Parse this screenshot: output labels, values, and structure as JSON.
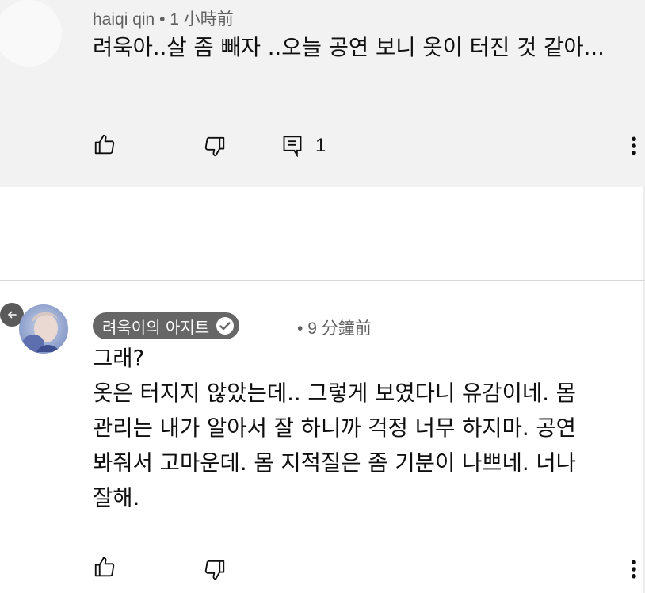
{
  "comments": [
    {
      "author": "haiqi qin",
      "separator": "•",
      "time": "1 小時前",
      "text": "려욱아..살 좀 빼자 ..오늘 공연 보니 옷이 터진 것 같아...",
      "reply_count": "1",
      "icons": [
        "like-icon",
        "dislike-icon",
        "reply-icon",
        "more-vert-icon"
      ]
    },
    {
      "author": "려욱이의 아지트",
      "author_verified": true,
      "separator": "•",
      "time": "9 分鐘前",
      "lines": [
        "그래?",
        "옷은 터지지 않았는데.. 그렇게 보였다니 유감이네. 몸",
        "관리는 내가 알아서 잘 하니까 걱정 너무 하지마. 공연",
        "봐줘서 고마운데. 몸 지적질은 좀 기분이 나쁘네. 너나",
        "잘해."
      ],
      "icons": [
        "like-icon",
        "dislike-icon",
        "more-vert-icon"
      ]
    }
  ],
  "colors": {
    "comment_bg": "#f2f2f2",
    "chip_bg": "#666666",
    "meta_text": "#606060"
  }
}
